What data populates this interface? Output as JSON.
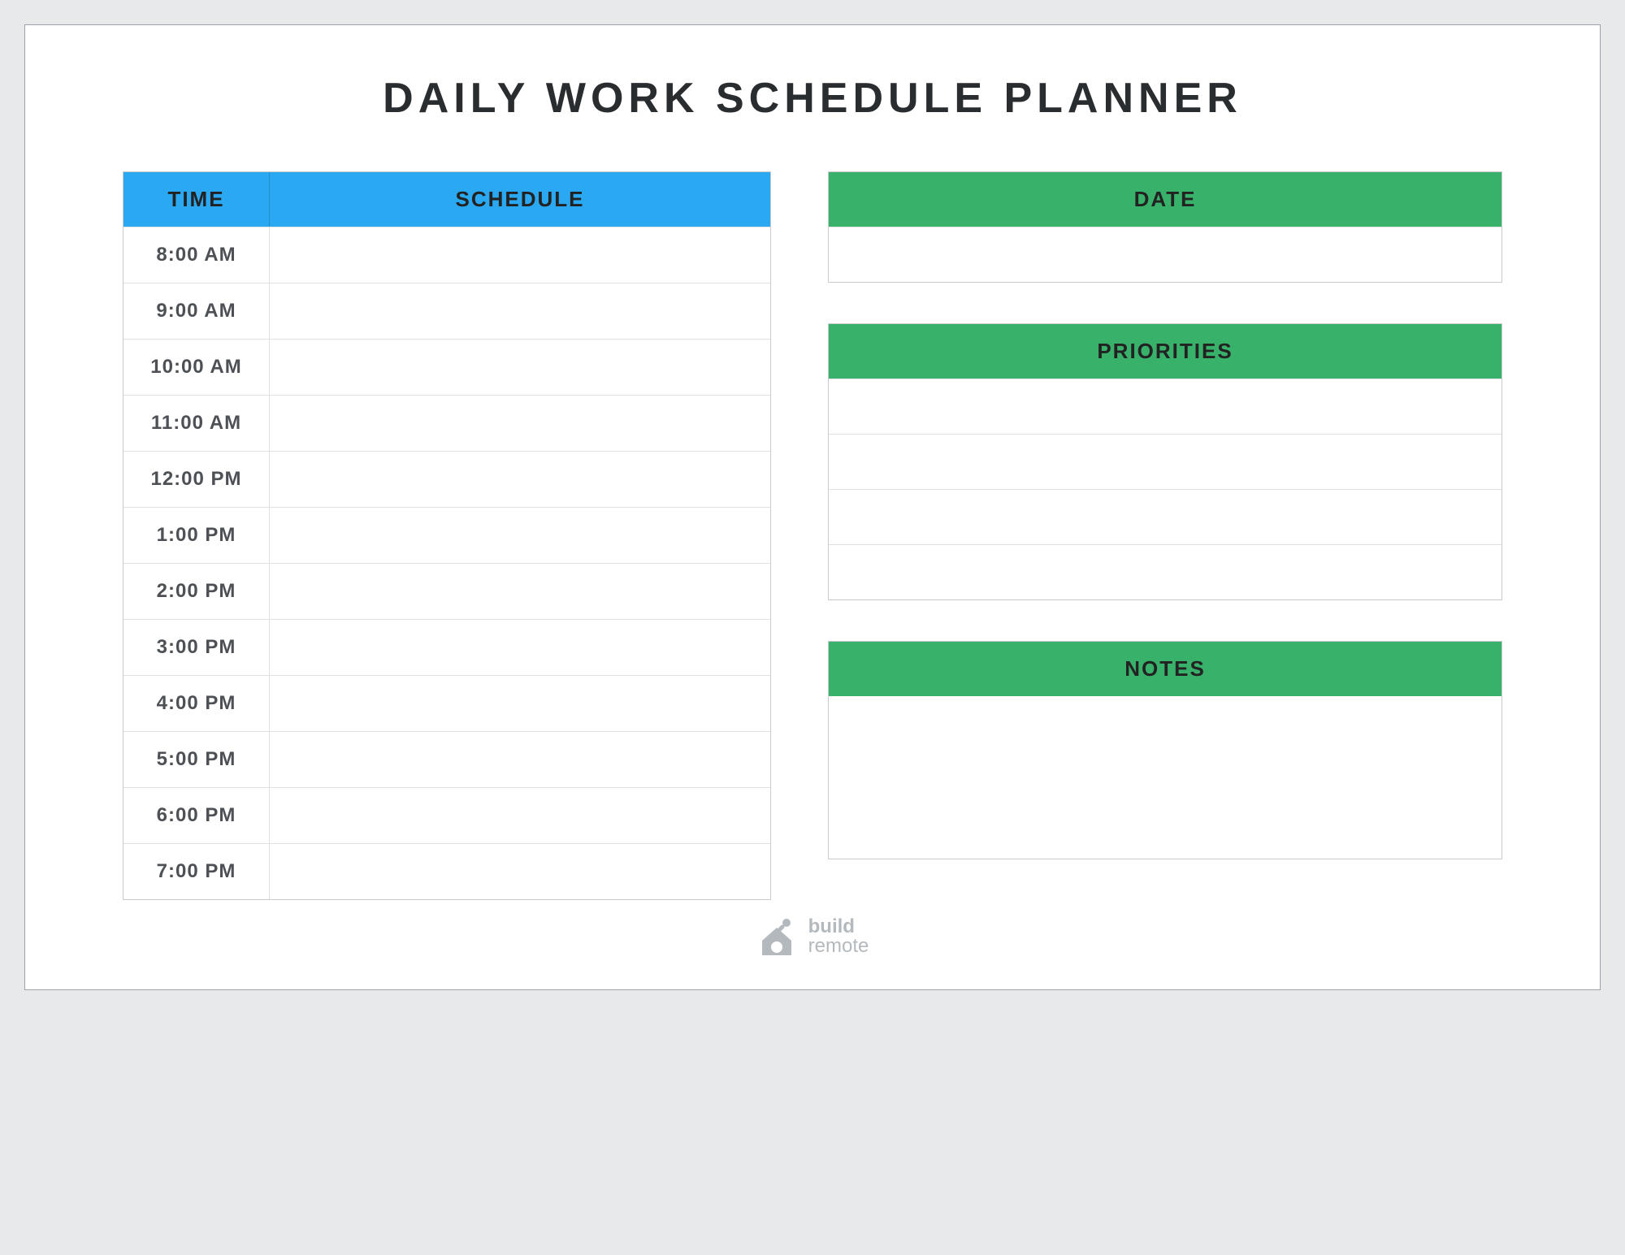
{
  "title": "DAILY WORK SCHEDULE PLANNER",
  "schedule": {
    "time_header": "TIME",
    "schedule_header": "SCHEDULE",
    "rows": [
      {
        "time": "8:00 AM",
        "entry": ""
      },
      {
        "time": "9:00 AM",
        "entry": ""
      },
      {
        "time": "10:00 AM",
        "entry": ""
      },
      {
        "time": "11:00 AM",
        "entry": ""
      },
      {
        "time": "12:00 PM",
        "entry": ""
      },
      {
        "time": "1:00 PM",
        "entry": ""
      },
      {
        "time": "2:00 PM",
        "entry": ""
      },
      {
        "time": "3:00 PM",
        "entry": ""
      },
      {
        "time": "4:00 PM",
        "entry": ""
      },
      {
        "time": "5:00 PM",
        "entry": ""
      },
      {
        "time": "6:00 PM",
        "entry": ""
      },
      {
        "time": "7:00 PM",
        "entry": ""
      }
    ]
  },
  "date": {
    "header": "DATE",
    "value": ""
  },
  "priorities": {
    "header": "PRIORITIES",
    "items": [
      "",
      "",
      "",
      ""
    ]
  },
  "notes": {
    "header": "NOTES",
    "value": ""
  },
  "footer": {
    "brand_line1": "build",
    "brand_line2": "remote"
  }
}
